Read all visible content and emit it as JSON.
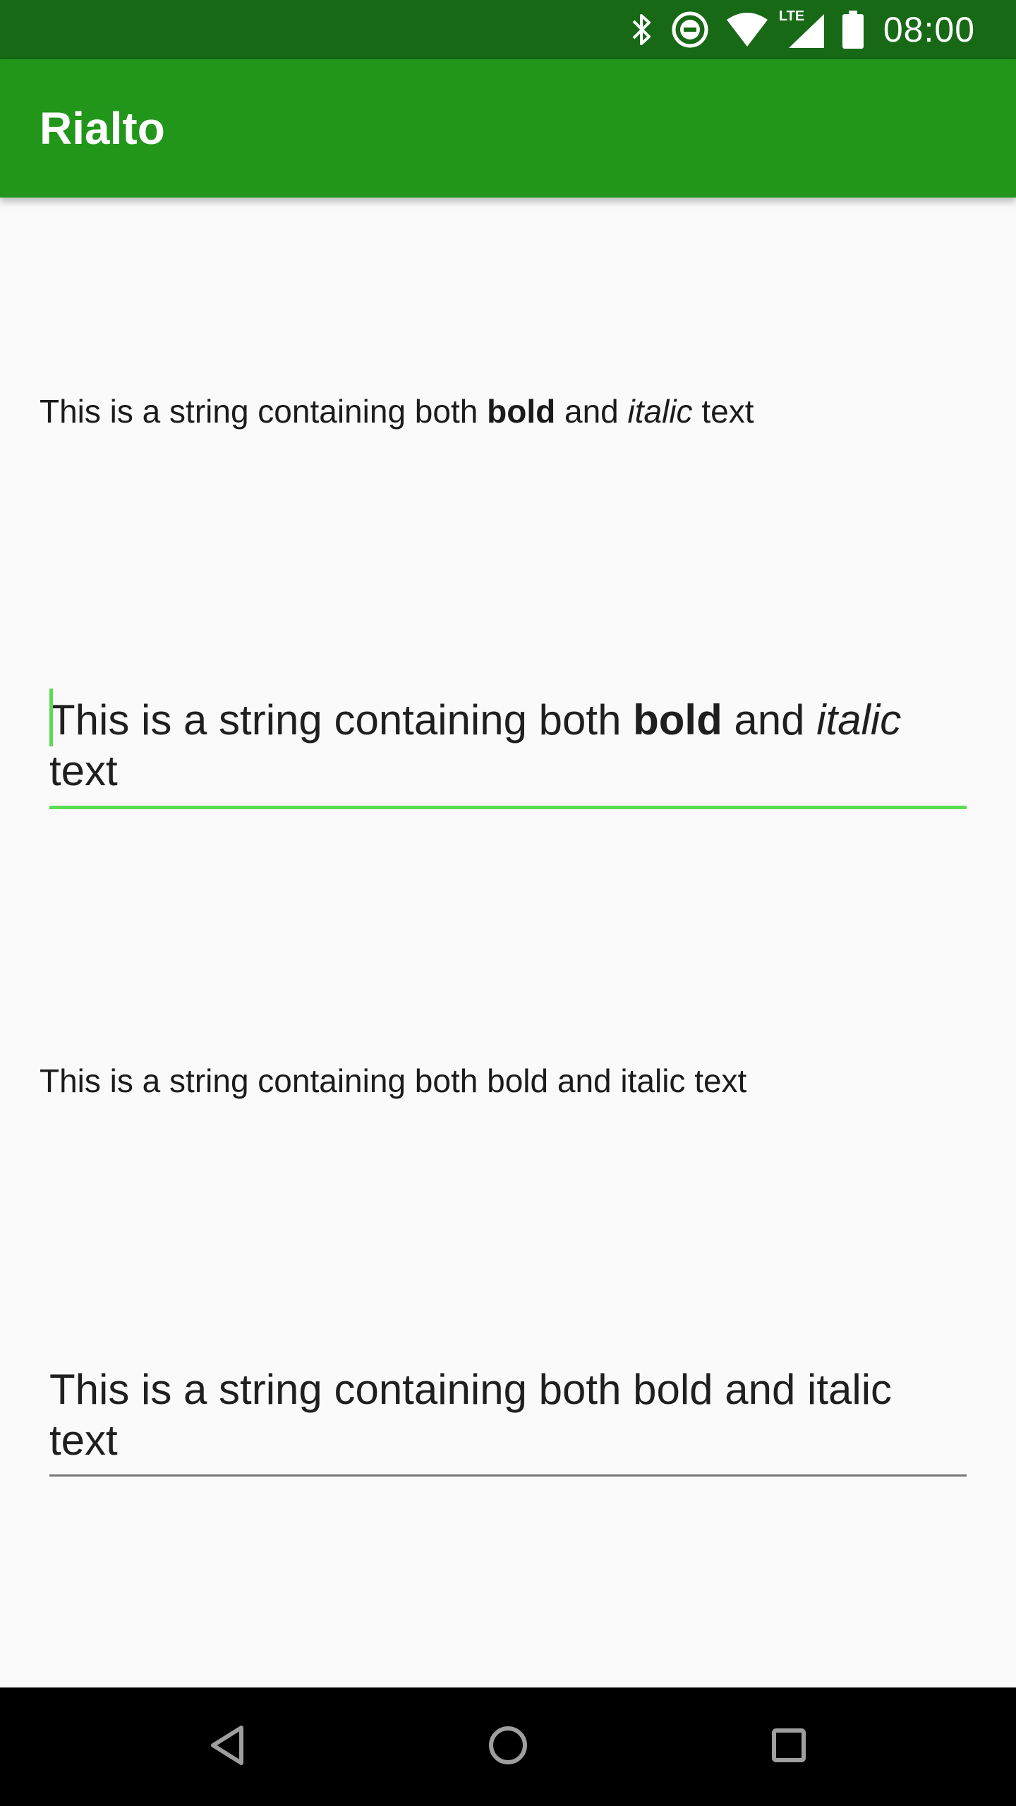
{
  "status_bar": {
    "time": "08:00",
    "icons": [
      "bluetooth-icon",
      "do-not-disturb-icon",
      "wifi-icon",
      "lte-signal-icon",
      "battery-icon"
    ],
    "network_label": "LTE",
    "background": "#176916"
  },
  "app_bar": {
    "title": "Rialto",
    "background": "#21961a"
  },
  "content": {
    "text1": {
      "prefix": "This is a string containing both ",
      "bold": "bold",
      "middle": " and ",
      "italic": "italic",
      "suffix": " text"
    },
    "edit1": {
      "prefix": "This is a string containing both ",
      "bold": "bold",
      "middle": " and ",
      "italic": "italic",
      "suffix": " text",
      "focused": true
    },
    "text2": "This is a string containing both bold and italic text",
    "edit2": "This is a string containing both bold and italic text"
  },
  "accent_color": "#5cdc54",
  "nav_bar": {
    "buttons": [
      "back-icon",
      "home-icon",
      "recents-icon"
    ]
  }
}
